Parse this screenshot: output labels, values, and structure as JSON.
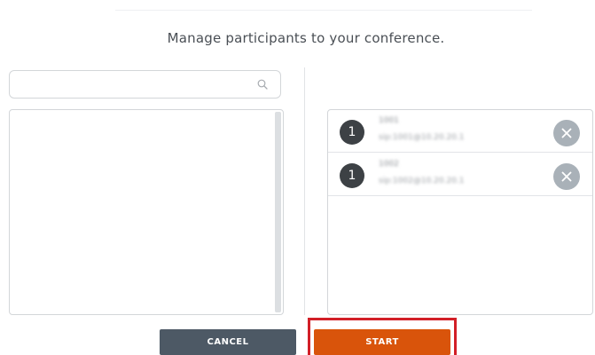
{
  "dialog": {
    "heading": "Manage participants to your conference."
  },
  "search": {
    "placeholder": "",
    "value": "",
    "icon": "search-icon"
  },
  "participants": [
    {
      "badge": "1",
      "name": "1001",
      "address": "sip:1001@10.20.20.1",
      "remove_icon": "close-icon"
    },
    {
      "badge": "1",
      "name": "1002",
      "address": "sip:1002@10.20.20.1",
      "remove_icon": "close-icon"
    }
  ],
  "actions": {
    "cancel_label": "CANCEL",
    "start_label": "START"
  },
  "colors": {
    "cancel_button": "#4d5965",
    "start_button": "#d9540b",
    "highlight_border": "#d21f27",
    "badge": "#3d4145",
    "remove_button": "#a9b1b8"
  }
}
